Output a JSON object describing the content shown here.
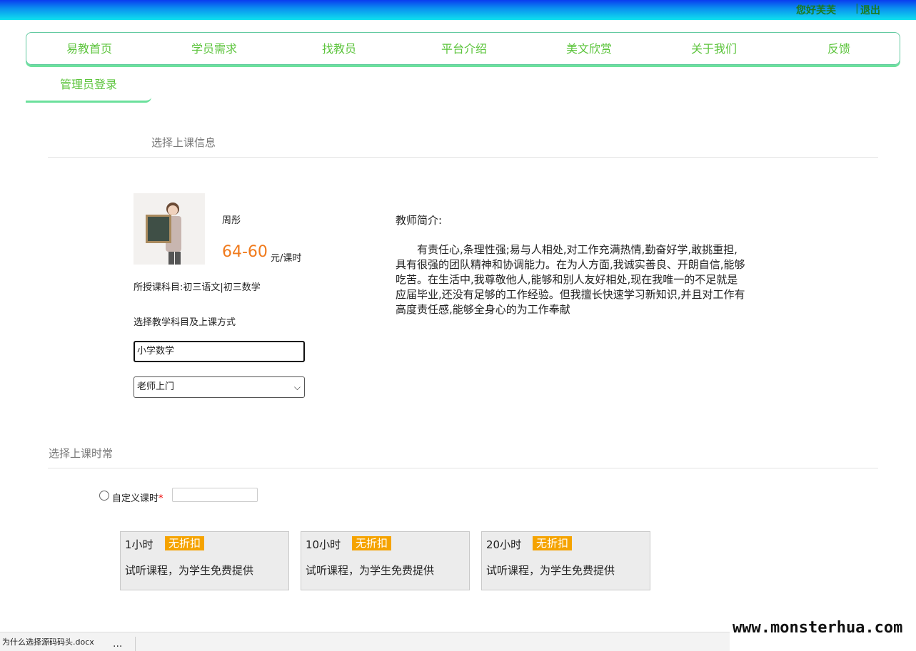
{
  "header": {
    "greeting": "您好芙芙",
    "separator": "|",
    "logout": "退出"
  },
  "nav": {
    "items": [
      "易教首页",
      "学员需求",
      "找教员",
      "平台介绍",
      "美文欣赏",
      "关于我们",
      "反馈"
    ],
    "admin": "管理员登录"
  },
  "section1": {
    "title": "选择上课信息"
  },
  "teacher": {
    "name": "周彤",
    "price": "64-60",
    "unit": "元/课时",
    "subjects": "所授课科目:初三语文|初三数学",
    "choose_label": "选择教学科目及上课方式",
    "subject_value": "小学数学",
    "mode_value": "老师上门",
    "intro_title": "教师简介:",
    "intro_body": "有责任心,条理性强;易与人相处,对工作充满热情,勤奋好学,敢挑重担,具有很强的团队精神和协调能力。在为人方面,我诚实善良、开朗自信,能够吃苦。在生活中,我尊敬他人,能够和别人友好相处,现在我唯一的不足就是应届毕业,还没有足够的工作经验。但我擅长快速学习新知识,并且对工作有高度责任感,能够全身心的为工作奉献"
  },
  "section2": {
    "title": "选择上课时常",
    "custom_label": "自定义课时",
    "required_mark": "*"
  },
  "packages": [
    {
      "hours": "1小时",
      "badge": "无折扣",
      "desc": "试听课程，为学生免费提供"
    },
    {
      "hours": "10小时",
      "badge": "无折扣",
      "desc": "试听课程，为学生免费提供"
    },
    {
      "hours": "20小时",
      "badge": "无折扣",
      "desc": "试听课程，为学生免费提供"
    }
  ],
  "download": {
    "file": "为什么选择源码码头.docx",
    "more": "..."
  },
  "watermark": "www.monsterhua.com",
  "colors": {
    "nav_text": "#5cc43c",
    "price": "#f07a1c",
    "badge": "#f5a300",
    "greeting": "#1d7a1d"
  }
}
